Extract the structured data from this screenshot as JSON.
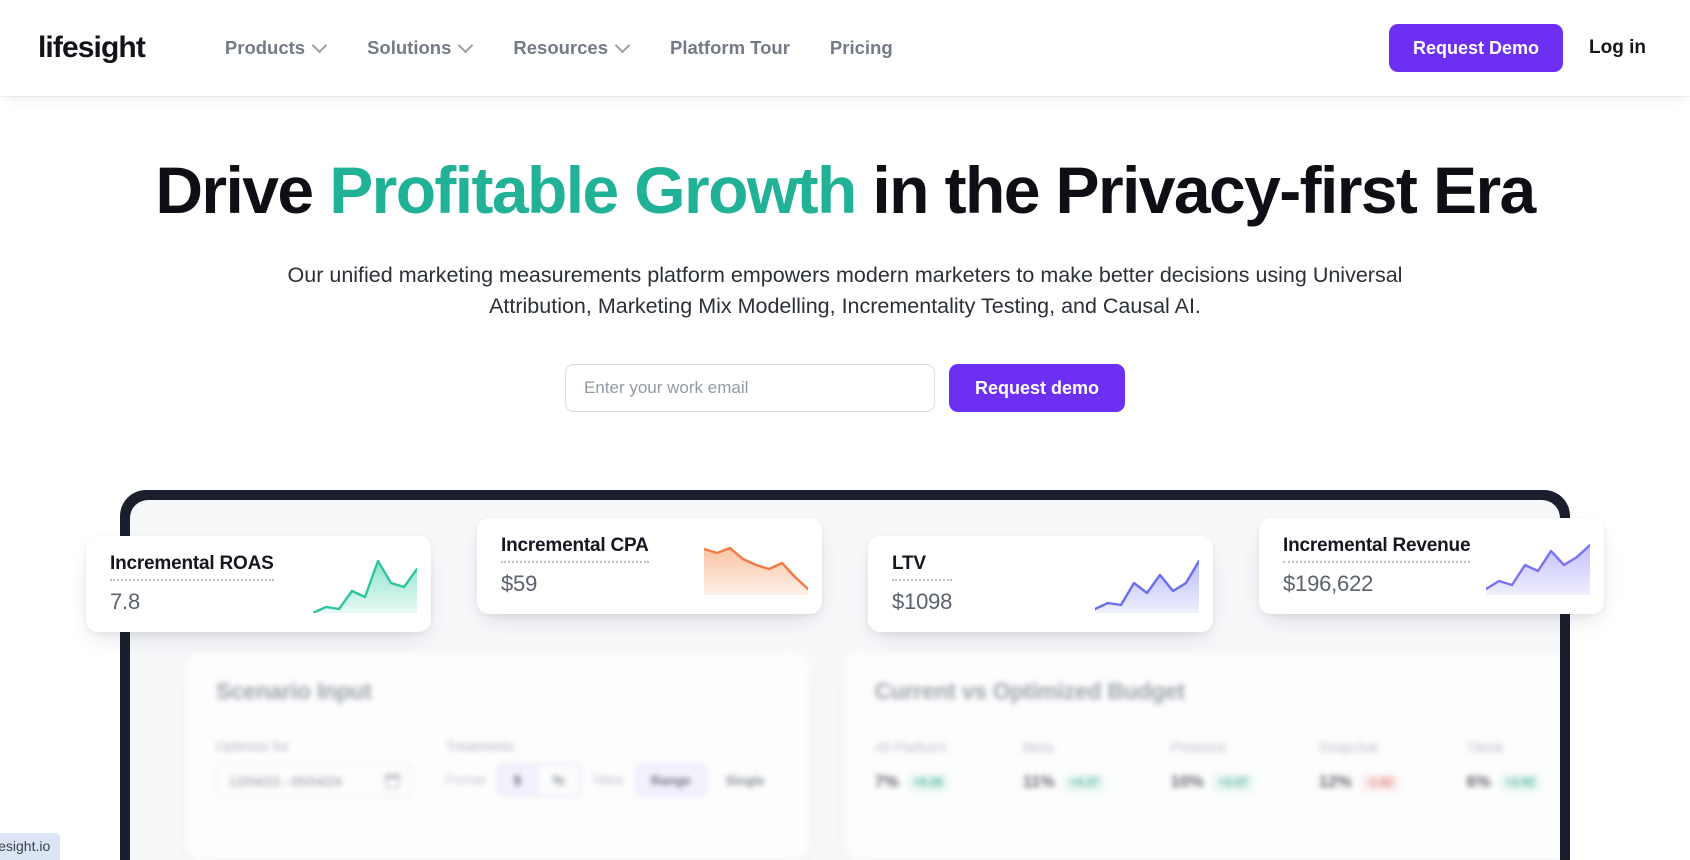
{
  "navbar": {
    "logo": "lifesight",
    "items": [
      {
        "label": "Products",
        "has_chevron": true,
        "icon": "chevron-down-icon"
      },
      {
        "label": "Solutions",
        "has_chevron": true,
        "icon": "chevron-down-icon"
      },
      {
        "label": "Resources",
        "has_chevron": true,
        "icon": "chevron-down-icon"
      },
      {
        "label": "Platform Tour",
        "has_chevron": false
      },
      {
        "label": "Pricing",
        "has_chevron": false
      }
    ],
    "request_demo": "Request Demo",
    "login": "Log in"
  },
  "hero": {
    "headline_part1": "Drive ",
    "headline_accent": "Profitable Growth",
    "headline_part2": " in the Privacy-first Era",
    "subhead": "Our unified marketing measurements platform empowers modern marketers to make better decisions using Universal Attribution, Marketing Mix Modelling, Incrementality Testing, and Causal AI.",
    "email_placeholder": "Enter your work email",
    "email_value": "",
    "cta": "Request demo"
  },
  "colors": {
    "accent_green": "#20b196",
    "brand_purple": "#6d30f2",
    "device_frame": "#1b1f2d",
    "spark_green": "#2ec4a0",
    "spark_orange": "#f07a42",
    "spark_blue": "#6a6ef0",
    "spark_indigo": "#7a72f5"
  },
  "metric_cards": [
    {
      "title": "Incremental ROAS",
      "value": "7.8",
      "spark_color": "#2ec4a0",
      "spark_fill_top": "#a6ead8",
      "spark_points": [
        0,
        6,
        4,
        22,
        16,
        52,
        30,
        26,
        44
      ]
    },
    {
      "title": "Incremental CPA",
      "value": "$59",
      "spark_color": "#f07a42",
      "spark_fill_top": "#fbd0b6",
      "spark_points": [
        46,
        42,
        47,
        36,
        30,
        26,
        32,
        18,
        6
      ]
    },
    {
      "title": "LTV",
      "value": "$1098",
      "spark_color": "#6a6ef0",
      "spark_fill_top": "#c3c5fa",
      "spark_points": [
        4,
        10,
        8,
        30,
        20,
        38,
        22,
        30,
        52
      ]
    },
    {
      "title": "Incremental Revenue",
      "value": "$196,622",
      "spark_color": "#7a72f5",
      "spark_fill_top": "#cbc7fb",
      "spark_points": [
        6,
        14,
        10,
        30,
        24,
        44,
        30,
        38,
        50
      ]
    }
  ],
  "scenario_panel": {
    "title": "Scenario Input",
    "optimize_label": "Optimize for",
    "date_range": "12/04/23 - 05/04/24",
    "calendar_icon": "calendar-icon",
    "treatments_label": "Treatments",
    "format_label": "Format",
    "format_options": [
      "$",
      "%"
    ],
    "format_selected": "$",
    "value_label": "Value",
    "value_options": [
      "Range",
      "Single"
    ],
    "value_selected": "Range"
  },
  "budget_panel": {
    "title": "Current vs Optimized Budget",
    "columns": [
      "All Platform",
      "Meta",
      "Pinterest",
      "Snapchat",
      "Tiktok"
    ],
    "values": [
      "7%",
      "11%",
      "10%",
      "12%",
      "6%"
    ],
    "deltas": [
      "+9.26",
      "+4.37",
      "+3.57",
      "-1.62",
      "+2.93"
    ],
    "delta_directions": [
      "up",
      "up",
      "up",
      "down",
      "up"
    ]
  },
  "status_link": "lifesight.io"
}
